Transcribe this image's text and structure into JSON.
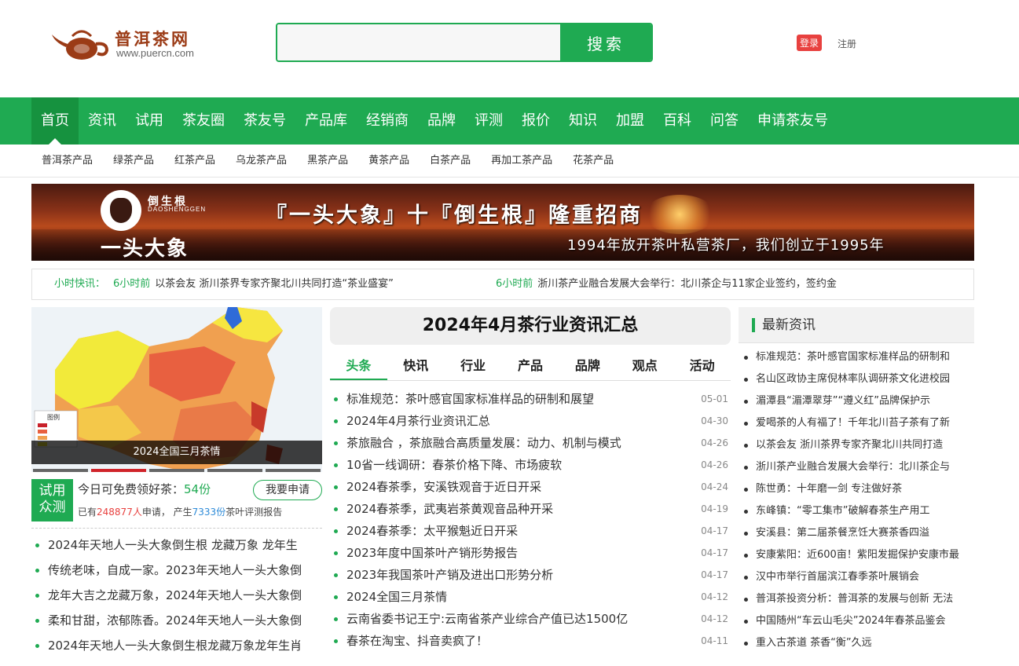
{
  "header": {
    "logo_cn": "普洱茶网",
    "logo_url": "www.puercn.com",
    "search_placeholder": "",
    "search_button": "搜索",
    "login": "登录",
    "register": "注册"
  },
  "main_nav": [
    "首页",
    "资讯",
    "试用",
    "茶友圈",
    "茶友号",
    "产品库",
    "经销商",
    "品牌",
    "评测",
    "报价",
    "知识",
    "加盟",
    "百科",
    "问答",
    "申请茶友号"
  ],
  "sub_nav": [
    "普洱茶产品",
    "绿茶产品",
    "红茶产品",
    "乌龙茶产品",
    "黑茶产品",
    "黄茶产品",
    "白茶产品",
    "再加工茶产品",
    "花茶产品"
  ],
  "banner": {
    "brand_small": "倒生根",
    "brand_en": "DAOSHENGGEN",
    "brand_big": "一头大象",
    "headline": "『一头大象』十『倒生根』隆重招商",
    "slogan": "1994年放开茶叶私营茶厂，我们创立于1995年"
  },
  "ticker": {
    "label": "小时快讯：",
    "items": [
      {
        "time": "6小时前",
        "text": "以茶会友 浙川茶界专家齐聚北川共同打造“茶业盛宴”"
      },
      {
        "time": "6小时前",
        "text": "浙川茶产业融合发展大会举行：北川茶企与11家企业签约，签约金"
      }
    ]
  },
  "feature": {
    "caption": "2024全国三月茶情",
    "legend_title": "图例"
  },
  "trial": {
    "badge_line1": "试用",
    "badge_line2": "众测",
    "today_text": "今日可免费领好茶：",
    "today_count": "54份",
    "apply_button": "我要申请",
    "stat_prefix": "已有",
    "stat_people": "248877人",
    "stat_mid": "申请， 产生",
    "stat_reports": "7333份",
    "stat_suffix": "茶叶评测报告"
  },
  "left_list": [
    "2024年天地人一头大象倒生根 龙藏万象 龙年生",
    "传统老味，自成一家。2023年天地人一头大象倒",
    "龙年大吉之龙藏万象，2024年天地人一头大象倒",
    "柔和甘甜，浓郁陈香。2024年天地人一头大象倒",
    "2024年天地人一头大象倒生根龙藏万象龙年生肖"
  ],
  "center": {
    "title": "2024年4月茶行业资讯汇总",
    "tabs": [
      "头条",
      "快讯",
      "行业",
      "产品",
      "品牌",
      "观点",
      "活动"
    ],
    "news": [
      {
        "title": "标准规范：茶叶感官国家标准样品的研制和展望",
        "date": "05-01"
      },
      {
        "title": "2024年4月茶行业资讯汇总",
        "date": "04-30"
      },
      {
        "title": "茶旅融合 ，茶旅融合高质量发展：动力、机制与模式",
        "date": "04-26"
      },
      {
        "title": "10省一线调研：春茶价格下降、市场疲软",
        "date": "04-26"
      },
      {
        "title": "2024春茶季，安溪铁观音于近日开采",
        "date": "04-24"
      },
      {
        "title": "2024春茶季，武夷岩茶黄观音品种开采",
        "date": "04-19"
      },
      {
        "title": "2024春茶季：太平猴魁近日开采",
        "date": "04-17"
      },
      {
        "title": "2023年度中国茶叶产销形势报告",
        "date": "04-17"
      },
      {
        "title": "2023年我国茶叶产销及进出口形势分析",
        "date": "04-17"
      },
      {
        "title": "2024全国三月茶情",
        "date": "04-12"
      },
      {
        "title": "云南省委书记王宁:云南省茶产业综合产值已达1500亿",
        "date": "04-12"
      },
      {
        "title": "春茶在淘宝、抖音卖疯了！",
        "date": "04-11"
      }
    ]
  },
  "right": {
    "title": "最新资讯",
    "items": [
      "标准规范：茶叶感官国家标准样品的研制和",
      "名山区政协主席倪林率队调研茶文化进校园",
      "湄潭县“湄潭翠芽”“遵义红”品牌保护示",
      "爱喝茶的人有福了！千年北川苔子茶有了新",
      "以茶会友 浙川茶界专家齐聚北川共同打造",
      "浙川茶产业融合发展大会举行：北川茶企与",
      "陈世勇：十年磨一剑 专注做好茶",
      "东峰镇：“零工集市”破解春茶生产用工",
      "安溪县：第二届茶餐烹饪大赛茶香四溢",
      "安康紫阳：近600亩！紫阳发掘保护安康市最",
      "汉中市举行首届滨江春季茶叶展销会",
      "普洱茶投资分析：普洱茶的发展与创新 无法",
      "中国随州“车云山毛尖”2024年春茶品鉴会",
      "重入古茶道 茶香“衡”久远"
    ]
  },
  "colors": {
    "brand_green": "#1faa52",
    "login_red": "#e8413f"
  }
}
